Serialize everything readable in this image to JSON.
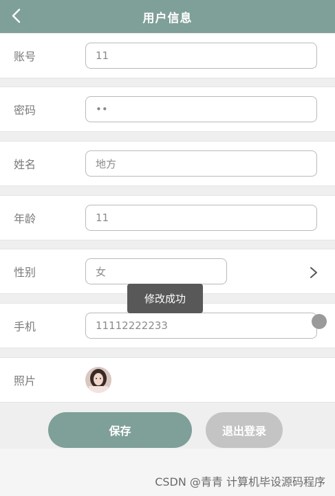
{
  "header": {
    "title": "用户信息",
    "back_icon": "chevron-left-icon"
  },
  "fields": {
    "account": {
      "label": "账号",
      "value": "11"
    },
    "password": {
      "label": "密码",
      "value": "••"
    },
    "name": {
      "label": "姓名",
      "value": "地方"
    },
    "age": {
      "label": "年龄",
      "value": "11"
    },
    "gender": {
      "label": "性别",
      "value": "女",
      "picker_icon": "chevron-right-icon"
    },
    "phone": {
      "label": "手机",
      "value": "11112222233"
    },
    "photo": {
      "label": "照片",
      "avatar_icon": "avatar-photo"
    }
  },
  "toast": {
    "text": "修改成功"
  },
  "buttons": {
    "save": "保存",
    "logout": "退出登录"
  },
  "watermark": "CSDN @青青  计算机毕设源码程序",
  "colors": {
    "accent": "#7f9f99",
    "logout": "#c4c4c4",
    "toast_bg": "#585858"
  }
}
